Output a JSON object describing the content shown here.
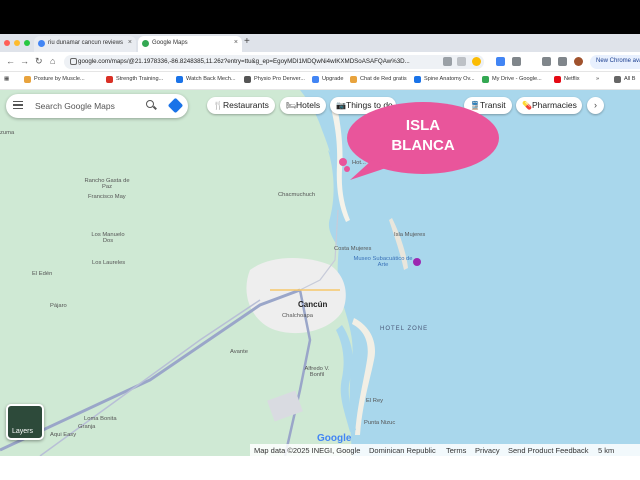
{
  "browser": {
    "tabs": [
      {
        "title": "riu dunamar cancun reviews",
        "favicon_color": "#4285f4"
      },
      {
        "title": "Google Maps",
        "favicon_color": "#34a853"
      }
    ],
    "new_tab_symbol": "+",
    "close_symbol": "×",
    "window_dots": [
      "#ff5f57",
      "#febc2e",
      "#28c840"
    ],
    "url": "google.com/maps/@21.1978336,-86.8248385,11.26z?entry=ttu&g_ep=EgoyMDI1MDQwNi4wIKXMDSoASAFQAw%3D...",
    "new_chrome_label": "New Chrome ava"
  },
  "bookmarks": [
    {
      "label": "Posture by Muscle...",
      "color": "#e8a33d"
    },
    {
      "label": "Strength Training...",
      "color": "#d93025"
    },
    {
      "label": "Watch Back Mech...",
      "color": "#1a73e8"
    },
    {
      "label": "Physio Pro Denver...",
      "color": "#555555"
    },
    {
      "label": "Upgrade",
      "color": "#4285f4"
    },
    {
      "label": "Chat de Red gratis",
      "color": "#e8a33d"
    },
    {
      "label": "Spine Anatomy Ov...",
      "color": "#1a73e8"
    },
    {
      "label": "My Drive - Google...",
      "color": "#34a853"
    },
    {
      "label": "Netflix",
      "color": "#e50914"
    },
    {
      "label": "All B",
      "color": "#666666"
    }
  ],
  "search": {
    "placeholder": "Search Google Maps"
  },
  "chips": [
    {
      "label": "Restaurants",
      "icon": "fork-knife-icon",
      "glyph": "🍴"
    },
    {
      "label": "Hotels",
      "icon": "bed-icon",
      "glyph": "🛏"
    },
    {
      "label": "Things to do",
      "icon": "camera-icon",
      "glyph": "📷"
    },
    {
      "label": "Transit",
      "icon": "train-icon",
      "glyph": "🚆"
    },
    {
      "label": "Pharmacies",
      "icon": "pill-icon",
      "glyph": "💊"
    }
  ],
  "chips_more_glyph": "›",
  "callout": {
    "line1": "ISLA",
    "line2": "BLANCA",
    "color": "#e9559b"
  },
  "map_labels": {
    "hotel": "Hot...",
    "places": [
      "Rancho Gasta de Paz",
      "Francisco May",
      "Los Manuelo Dos",
      "Los Laureles",
      "El Edén",
      "Pájaro",
      "Avante",
      "Alfredo V. Bonfil",
      "Loma Bonita",
      "Aqui Easy",
      "Chacmuchuch",
      "Costa Mujeres",
      "Isla Mujeres",
      "Chalchoapa",
      "El Rey",
      "Punta Nizuc",
      "Granja"
    ],
    "museum": "Museo Subacuático de Arte",
    "city": "Cancún",
    "hotel_zone": "HOTEL ZONE",
    "edge_left": "zuma"
  },
  "layers_label": "Layers",
  "google_mark": "Google",
  "footer": {
    "items": [
      "Map data ©2025 INEGI, Google",
      "Dominican Republic",
      "Terms",
      "Privacy",
      "Send Product Feedback",
      "5 km"
    ]
  },
  "colors": {
    "land": "#cfe9d4",
    "water": "#a9d7ec",
    "urban": "#eeeeee",
    "road_main": "#9aa6c9",
    "accent": "#1a73e8"
  }
}
